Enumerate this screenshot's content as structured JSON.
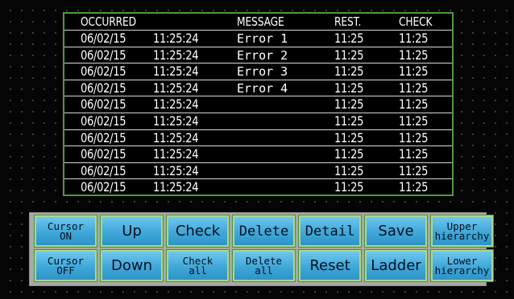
{
  "header": {
    "occurred": "OCCURRED",
    "message": "MESSAGE",
    "rest": "REST.",
    "check": "CHECK"
  },
  "rows": [
    {
      "date": "06/02/15",
      "time": "11:25:24",
      "message": "Error 1",
      "rest": "11:25",
      "check": "11:25"
    },
    {
      "date": "06/02/15",
      "time": "11:25:24",
      "message": "Error 2",
      "rest": "11:25",
      "check": "11:25"
    },
    {
      "date": "06/02/15",
      "time": "11:25:24",
      "message": "Error 3",
      "rest": "11:25",
      "check": "11:25"
    },
    {
      "date": "06/02/15",
      "time": "11:25:24",
      "message": "Error 4",
      "rest": "11:25",
      "check": "11:25"
    },
    {
      "date": "06/02/15",
      "time": "11:25:24",
      "message": "",
      "rest": "11:25",
      "check": "11:25"
    },
    {
      "date": "06/02/15",
      "time": "11:25:24",
      "message": "",
      "rest": "11:25",
      "check": "11:25"
    },
    {
      "date": "06/02/15",
      "time": "11:25:24",
      "message": "",
      "rest": "11:25",
      "check": "11:25"
    },
    {
      "date": "06/02/15",
      "time": "11:25:24",
      "message": "",
      "rest": "11:25",
      "check": "11:25"
    },
    {
      "date": "06/02/15",
      "time": "11:25:24",
      "message": "",
      "rest": "11:25",
      "check": "11:25"
    },
    {
      "date": "06/02/15",
      "time": "11:25:24",
      "message": "",
      "rest": "11:25",
      "check": "11:25"
    }
  ],
  "buttons": {
    "cursor_on": "Cursor\nON",
    "up": "Up",
    "check": "Check",
    "delete": "Delete",
    "detail": "Detail",
    "save": "Save",
    "upper_hierarchy": "Upper\nhierarchy",
    "cursor_off": "Cursor\nOFF",
    "down": "Down",
    "check_all": "Check\nall",
    "delete_all": "Delete\nall",
    "reset": "Reset",
    "ladder": "Ladder",
    "lower_hierarchy": "Lower\nhierarchy"
  },
  "colors": {
    "background": "#050505",
    "panel_border": "#4e9a3e",
    "button_face": "#3fa7d9",
    "button_border": "#a9d98c",
    "button_area": "#a9a9a9",
    "text": "#ffffff"
  }
}
